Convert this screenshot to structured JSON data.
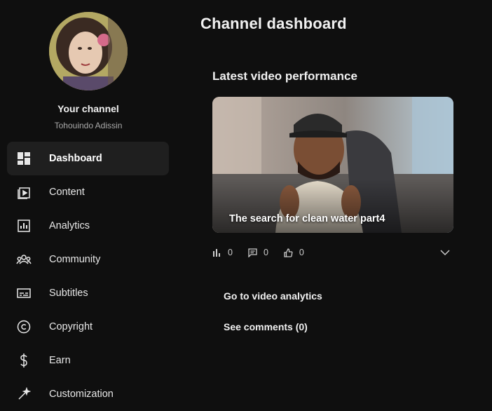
{
  "sidebar": {
    "channel_label": "Your channel",
    "channel_name": "Tohouindo Adissin",
    "items": [
      {
        "label": "Dashboard",
        "icon": "dashboard-icon",
        "active": true
      },
      {
        "label": "Content",
        "icon": "content-icon"
      },
      {
        "label": "Analytics",
        "icon": "analytics-icon"
      },
      {
        "label": "Community",
        "icon": "community-icon"
      },
      {
        "label": "Subtitles",
        "icon": "subtitles-icon"
      },
      {
        "label": "Copyright",
        "icon": "copyright-icon"
      },
      {
        "label": "Earn",
        "icon": "earn-icon"
      },
      {
        "label": "Customization",
        "icon": "customization-icon"
      }
    ]
  },
  "main": {
    "page_title": "Channel dashboard",
    "latest": {
      "section_title": "Latest video performance",
      "video_title": "The search for clean water part4",
      "stats": {
        "views": "0",
        "comments": "0",
        "likes": "0"
      },
      "analytics_button": "Go to video analytics",
      "comments_button": "See comments (0)"
    }
  },
  "colors": {
    "background": "#0f0f0f",
    "active_item": "#1f1f1f",
    "text": "#f1f1f1",
    "muted": "#aaaaaa"
  }
}
